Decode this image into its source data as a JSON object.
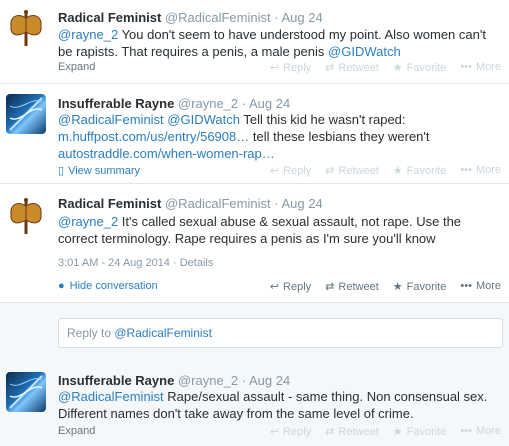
{
  "tweets": [
    {
      "fullname": "Radical Feminist",
      "username": "@RadicalFeminist",
      "time": "Aug 24",
      "text_parts": [
        "@rayne_2",
        "  You don't seem to have understood my point.  Also women can't be rapists.  That requires a penis, a male penis ",
        "@GIDWatch"
      ],
      "expand": "Expand"
    },
    {
      "fullname": "Insufferable Rayne",
      "username": "@rayne_2",
      "time": "Aug 24",
      "text_parts": [
        "@RadicalFeminist",
        " ",
        "@GIDWatch",
        " Tell this kid he wasn't raped: ",
        "m.huffpost.com/us/entry/56908…",
        " tell these lesbians they weren't ",
        "autostraddle.com/when-women-rap…"
      ],
      "expand": "View summary"
    },
    {
      "fullname": "Radical Feminist",
      "username": "@RadicalFeminist",
      "time": "Aug 24",
      "text_parts": [
        "@rayne_2",
        " It's called sexual abuse & sexual assault, not rape.  Use the correct terminology. Rape requires a penis as I'm sure you'll know"
      ],
      "timestamp": "3:01 AM - 24 Aug 2014",
      "details": "Details",
      "expand": "Hide conversation"
    },
    {
      "fullname": "Insufferable Rayne",
      "username": "@rayne_2",
      "time": "Aug 24",
      "text_parts": [
        "@RadicalFeminist",
        " Rape/sexual assault - same thing. Non consensual sex. Different names don't take away from the same level of crime."
      ],
      "expand": "Expand"
    }
  ],
  "actions": {
    "reply": "Reply",
    "retweet": "Retweet",
    "favorite": "Favorite",
    "more": "More"
  },
  "reply_box": {
    "prefix": "Reply to ",
    "mention": "@RadicalFeminist"
  },
  "separator": "·",
  "icons": {
    "reply": "reply-icon",
    "retweet": "retweet-icon",
    "favorite": "star-icon",
    "more": "more-dots-icon",
    "summary": "document-icon",
    "hide": "speech-bubble-icon"
  }
}
